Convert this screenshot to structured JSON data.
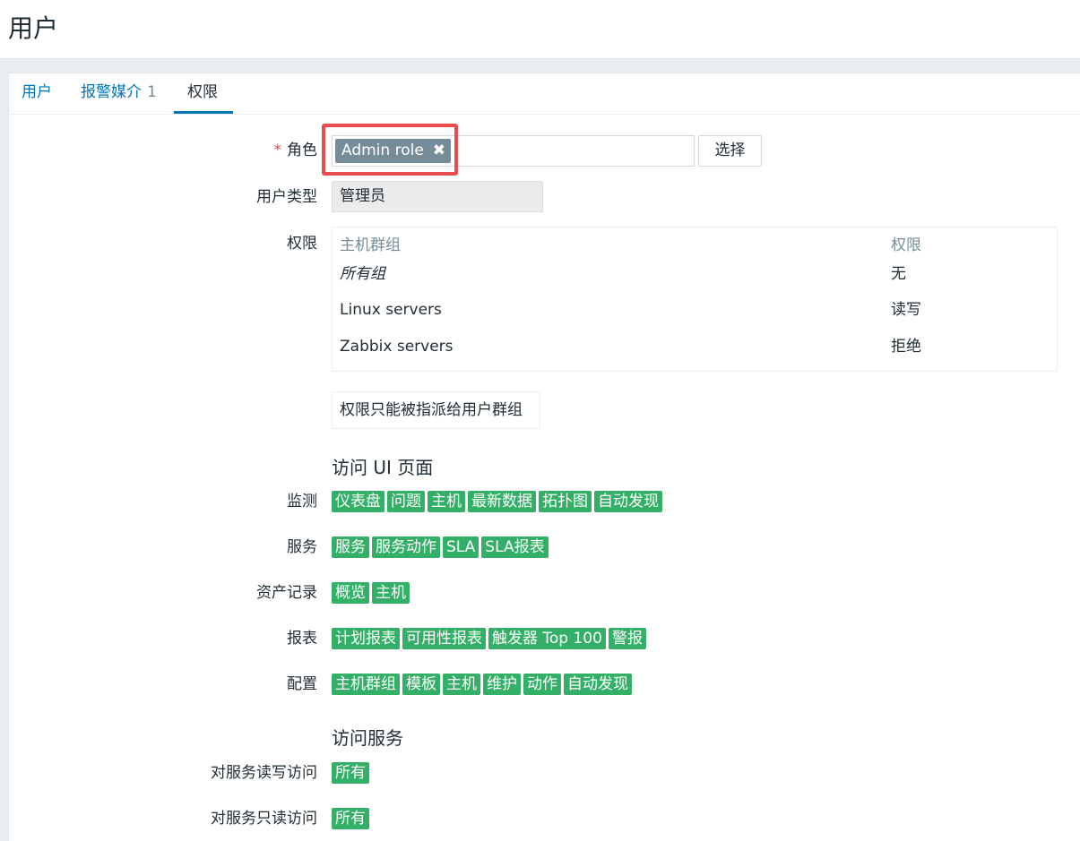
{
  "page": {
    "title": "用户"
  },
  "tabs": [
    {
      "label": "用户",
      "count": ""
    },
    {
      "label": "报警媒介",
      "count": "1"
    },
    {
      "label": "权限",
      "count": ""
    }
  ],
  "form": {
    "role": {
      "required_mark": "*",
      "label": "角色",
      "chip": "Admin role",
      "chip_remove": "✖",
      "select_button": "选择"
    },
    "user_type": {
      "label": "用户类型",
      "value": "管理员"
    },
    "permissions": {
      "label": "权限",
      "headers": [
        "主机群组",
        "权限"
      ],
      "rows": [
        {
          "group": "所有组",
          "permission": "无"
        },
        {
          "group": "Linux servers",
          "permission": "读写"
        },
        {
          "group": "Zabbix servers",
          "permission": "拒绝"
        }
      ],
      "note": "权限只能被指派给用户群组"
    }
  },
  "ui_access": {
    "title": "访问 UI 页面",
    "rows": [
      {
        "label": "监测",
        "tags": [
          "仪表盘",
          "问题",
          "主机",
          "最新数据",
          "拓扑图",
          "自动发现"
        ]
      },
      {
        "label": "服务",
        "tags": [
          "服务",
          "服务动作",
          "SLA",
          "SLA报表"
        ]
      },
      {
        "label": "资产记录",
        "tags": [
          "概览",
          "主机"
        ]
      },
      {
        "label": "报表",
        "tags": [
          "计划报表",
          "可用性报表",
          "触发器 Top 100",
          "警报"
        ]
      },
      {
        "label": "配置",
        "tags": [
          "主机群组",
          "模板",
          "主机",
          "维护",
          "动作",
          "自动发现"
        ]
      }
    ]
  },
  "service_access": {
    "title": "访问服务",
    "rows": [
      {
        "label": "对服务读写访问",
        "tags": [
          "所有"
        ]
      },
      {
        "label": "对服务只读访问",
        "tags": [
          "所有"
        ]
      }
    ]
  },
  "colors": {
    "accent": "#0275b8",
    "tag_green": "#34af67",
    "chip_gray": "#768d99",
    "highlight_red": "#e84c4c"
  }
}
